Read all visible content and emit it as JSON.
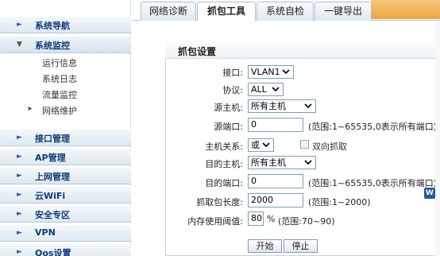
{
  "sidebar": {
    "items": [
      {
        "label": "系统导航"
      },
      {
        "label": "系统监控"
      },
      {
        "label": "接口管理"
      },
      {
        "label": "AP管理"
      },
      {
        "label": "上网管理"
      },
      {
        "label": "云WiFi"
      },
      {
        "label": "安全专区"
      },
      {
        "label": "VPN"
      },
      {
        "label": "Qos设置"
      }
    ],
    "sub_items": [
      {
        "label": "运行信息"
      },
      {
        "label": "系统日志"
      },
      {
        "label": "流量监控"
      },
      {
        "label": "网络维护"
      }
    ]
  },
  "tabs": [
    {
      "label": "网络诊断"
    },
    {
      "label": "抓包工具"
    },
    {
      "label": "系统自检"
    },
    {
      "label": "一键导出"
    }
  ],
  "panel": {
    "title": "抓包设置",
    "interface": {
      "label": "接口:",
      "value": "VLAN1"
    },
    "protocol": {
      "label": "协议:",
      "value": "ALL"
    },
    "src_host": {
      "label": "源主机:",
      "value": "所有主机"
    },
    "src_port": {
      "label": "源端口:",
      "value": "0",
      "hint": "(范围:1~65535,0表示所有端口)"
    },
    "host_relation": {
      "label": "主机关系:",
      "value": "或",
      "checkbox_label": "双向抓取"
    },
    "dst_host": {
      "label": "目的主机:",
      "value": "所有主机"
    },
    "dst_port": {
      "label": "目的端口:",
      "value": "0",
      "hint": "(范围:1~65535,0表示所有端口)"
    },
    "packet_length": {
      "label": "抓取包长度:",
      "value": "2000",
      "hint": "(范围:1~2000)"
    },
    "memory_threshold": {
      "label": "内存使用阈值:",
      "value": "80",
      "unit": "%",
      "hint": "(范围:70~90)"
    },
    "start_label": "开始",
    "stop_label": "停止"
  },
  "icons": {
    "word_icon": "W"
  }
}
